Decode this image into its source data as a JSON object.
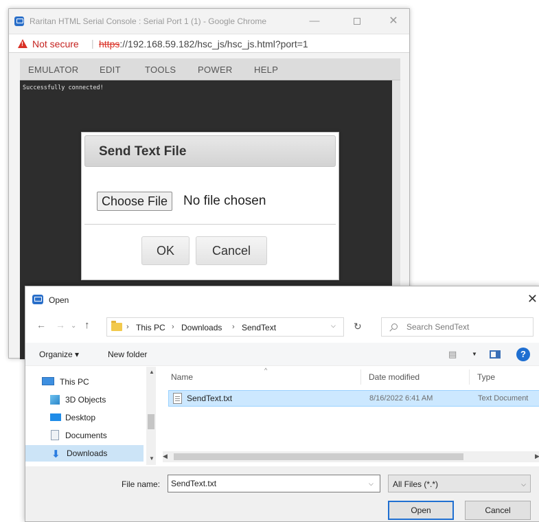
{
  "chrome": {
    "title": "Raritan HTML Serial Console : Serial Port 1 (1) - Google Chrome",
    "not_secure": "Not secure",
    "url_protocol": "https",
    "url_rest": "://192.168.59.182/hsc_js/hsc_js.html?port=1",
    "minimize": "—",
    "close": "✕"
  },
  "console": {
    "menu": [
      "EMULATOR",
      "EDIT",
      "TOOLS",
      "POWER",
      "HELP"
    ],
    "terminal_text": "Successfully connected!"
  },
  "send_dialog": {
    "title": "Send Text File",
    "choose_file": "Choose File",
    "no_file": "No file chosen",
    "ok": "OK",
    "cancel": "Cancel"
  },
  "open_dialog": {
    "title": "Open",
    "close": "✕",
    "breadcrumb": [
      "This PC",
      "Downloads",
      "SendText"
    ],
    "search_placeholder": "Search SendText",
    "organize": "Organize ▾",
    "new_folder": "New folder",
    "help": "?",
    "nav_items": [
      "This PC",
      "3D Objects",
      "Desktop",
      "Documents",
      "Downloads"
    ],
    "columns": {
      "name": "Name",
      "date": "Date modified",
      "type": "Type"
    },
    "files": [
      {
        "name": "SendText.txt",
        "date": "8/16/2022 6:41 AM",
        "type": "Text Document"
      }
    ],
    "file_name_label": "File name:",
    "file_name_value": "SendText.txt",
    "filter": "All Files (*.*)",
    "open": "Open",
    "cancel": "Cancel"
  },
  "colors": {
    "warning": "#d93025",
    "terminal_bg": "#2d2d2d",
    "selection": "#cce8ff",
    "accent": "#1f6fd1"
  }
}
